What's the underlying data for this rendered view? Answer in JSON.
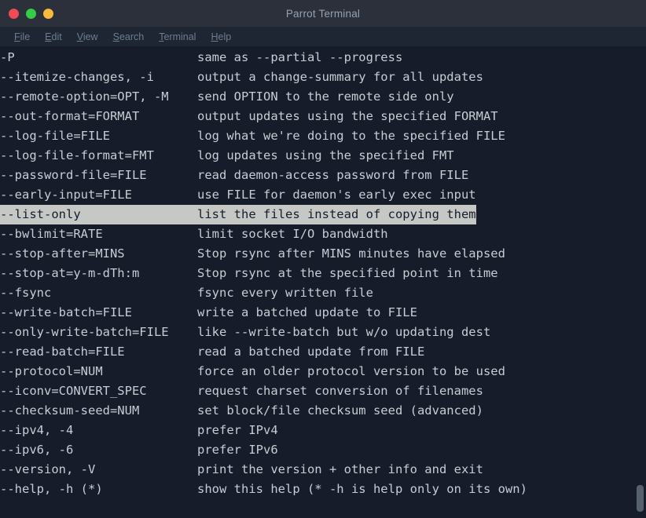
{
  "window": {
    "title": "Parrot Terminal",
    "controls": [
      {
        "name": "close",
        "color": "#ee4b55"
      },
      {
        "name": "minimize",
        "color": "#35cc46"
      },
      {
        "name": "maximize",
        "color": "#f7ba3e"
      }
    ]
  },
  "menubar": {
    "items": [
      {
        "label": "File",
        "mnemonic": "F"
      },
      {
        "label": "Edit",
        "mnemonic": "E"
      },
      {
        "label": "View",
        "mnemonic": "V"
      },
      {
        "label": "Search",
        "mnemonic": "S"
      },
      {
        "label": "Terminal",
        "mnemonic": "T"
      },
      {
        "label": "Help",
        "mnemonic": "H"
      }
    ]
  },
  "terminal": {
    "colors": {
      "background": "#161c29",
      "foreground": "#c8ccd4",
      "selection_background": "#c6c8c6",
      "selection_foreground": "#161c29",
      "titlebar": "#2b303b",
      "menubar": "#1e2634"
    },
    "selected_line_index": 8,
    "lines": [
      {
        "option": "-P",
        "description": "same as --partial --progress"
      },
      {
        "option": "--itemize-changes, -i",
        "description": "output a change-summary for all updates"
      },
      {
        "option": "--remote-option=OPT, -M",
        "description": "send OPTION to the remote side only"
      },
      {
        "option": "--out-format=FORMAT",
        "description": "output updates using the specified FORMAT"
      },
      {
        "option": "--log-file=FILE",
        "description": "log what we're doing to the specified FILE"
      },
      {
        "option": "--log-file-format=FMT",
        "description": "log updates using the specified FMT"
      },
      {
        "option": "--password-file=FILE",
        "description": "read daemon-access password from FILE"
      },
      {
        "option": "--early-input=FILE",
        "description": "use FILE for daemon's early exec input"
      },
      {
        "option": "--list-only",
        "description": "list the files instead of copying them"
      },
      {
        "option": "--bwlimit=RATE",
        "description": "limit socket I/O bandwidth"
      },
      {
        "option": "--stop-after=MINS",
        "description": "Stop rsync after MINS minutes have elapsed"
      },
      {
        "option": "--stop-at=y-m-dTh:m",
        "description": "Stop rsync at the specified point in time"
      },
      {
        "option": "--fsync",
        "description": "fsync every written file"
      },
      {
        "option": "--write-batch=FILE",
        "description": "write a batched update to FILE"
      },
      {
        "option": "--only-write-batch=FILE",
        "description": "like --write-batch but w/o updating dest"
      },
      {
        "option": "--read-batch=FILE",
        "description": "read a batched update from FILE"
      },
      {
        "option": "--protocol=NUM",
        "description": "force an older protocol version to be used"
      },
      {
        "option": "--iconv=CONVERT_SPEC",
        "description": "request charset conversion of filenames"
      },
      {
        "option": "--checksum-seed=NUM",
        "description": "set block/file checksum seed (advanced)"
      },
      {
        "option": "--ipv4, -4",
        "description": "prefer IPv4"
      },
      {
        "option": "--ipv6, -6",
        "description": "prefer IPv6"
      },
      {
        "option": "--version, -V",
        "description": "print the version + other info and exit"
      },
      {
        "option": "--help, -h (*)",
        "description": "show this help (* -h is help only on its own)"
      }
    ]
  }
}
